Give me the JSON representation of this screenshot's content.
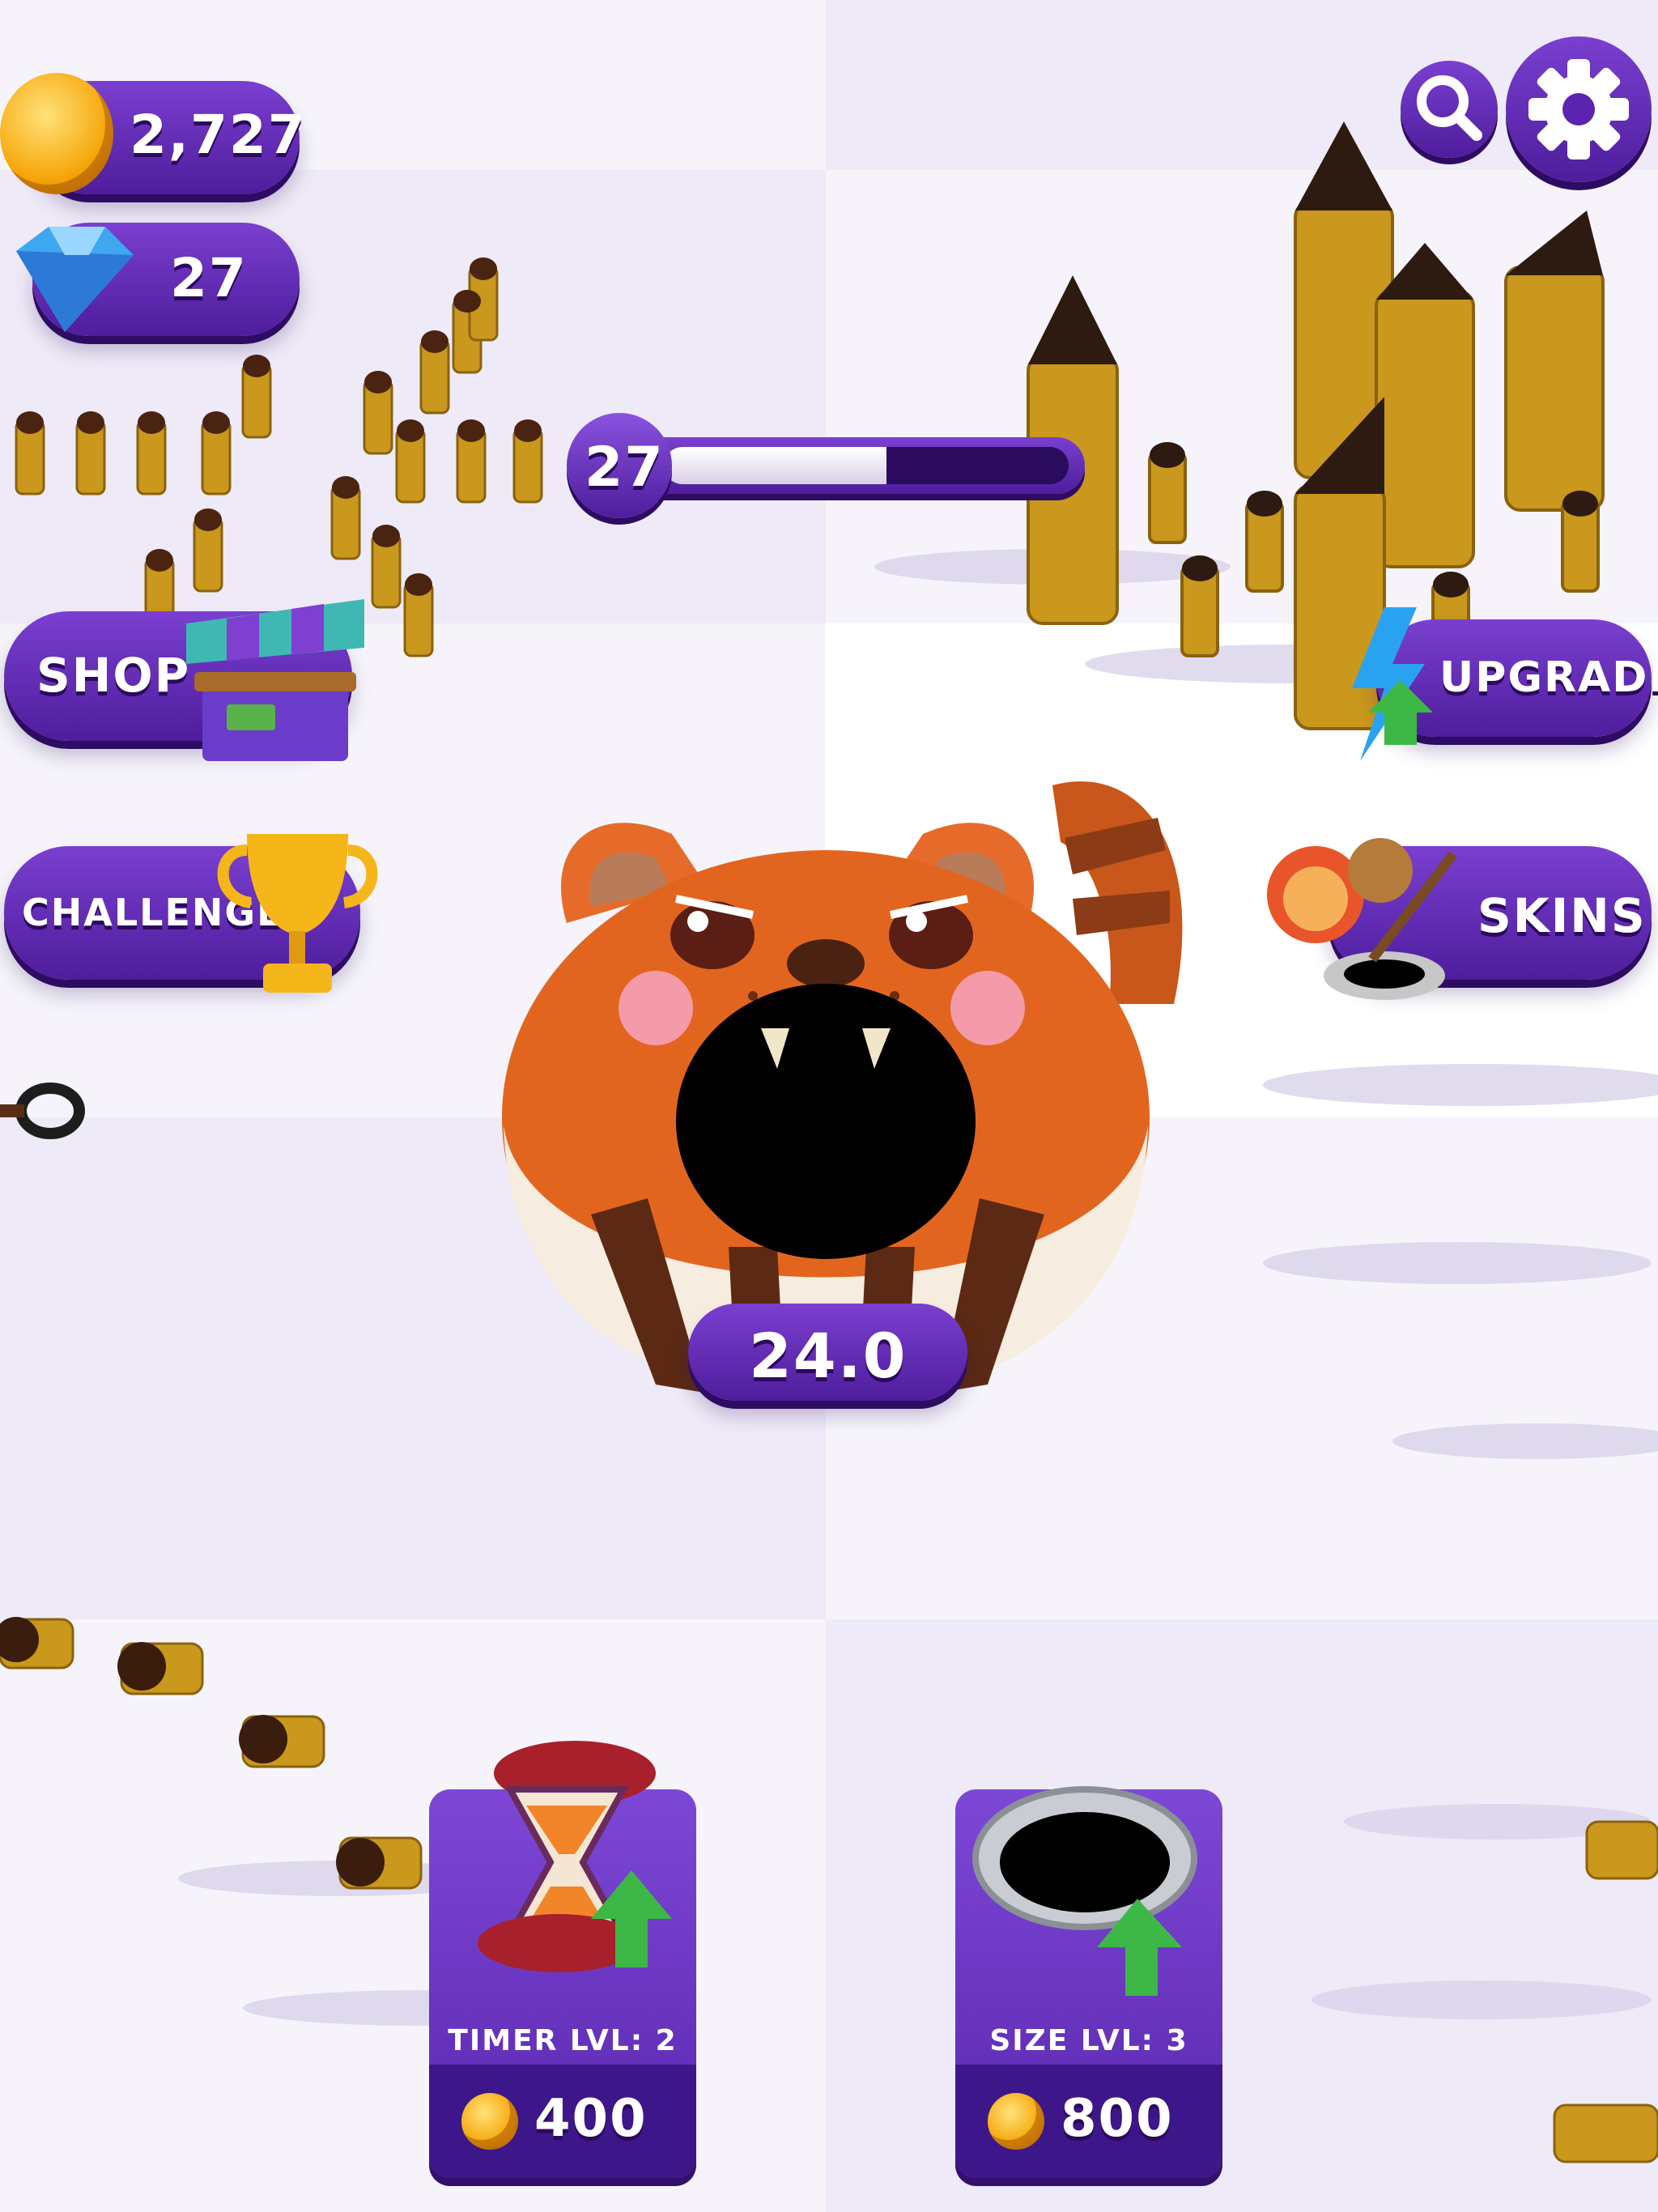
{
  "currency": {
    "coins": "2,727",
    "gems": "27"
  },
  "level": {
    "number": "27",
    "progress": 0.55
  },
  "menu": {
    "shop_label": "SHOP",
    "upgrade_label": "UPGRADE",
    "challenges_label": "CHALLENGES",
    "skins_label": "SKINS"
  },
  "hole": {
    "timer": "24.0"
  },
  "upgrades": [
    {
      "label": "TIMER LVL: 2",
      "cost": "400",
      "icon": "hourglass-icon"
    },
    {
      "label": "SIZE LVL: 3",
      "cost": "800",
      "icon": "hole-ring-icon"
    }
  ],
  "icons": {
    "zoom": "magnifier-icon",
    "settings": "gear-icon",
    "coin": "coin-icon",
    "gem": "diamond-icon"
  },
  "colors": {
    "accent": "#5b23b0",
    "coin": "#f6a70b",
    "progress_fill": "#ffffff",
    "progress_track": "#2a0b5e"
  }
}
